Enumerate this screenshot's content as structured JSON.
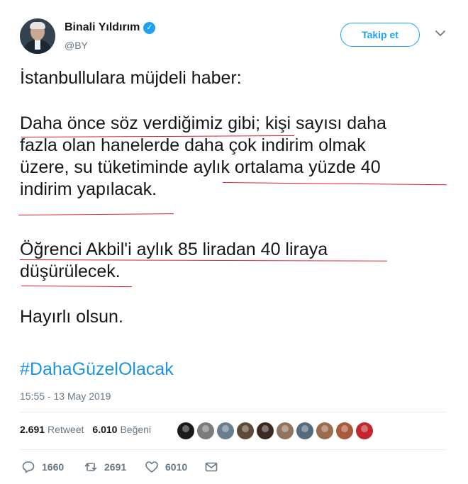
{
  "author": {
    "name": "Binali Yıldırım",
    "handle": "@BY",
    "verified_icon": "verified-badge-icon"
  },
  "header": {
    "follow_label": "Takip et"
  },
  "tweet": {
    "line1": "İstanbullulara müjdeli haber:",
    "p2_l1": "Daha önce söz verdiğimiz gibi; kişi sayısı daha",
    "p2_l2": "fazla olan hanelerde daha çok indirim olmak",
    "p2_l3": "üzere, su tüketiminde aylık ortalama yüzde 40",
    "p2_l4": "indirim yapılacak.",
    "p3_l1": "Öğrenci Akbil'i aylık 85 liradan 40 liraya",
    "p3_l2": "düşürülecek.",
    "closing": "Hayırlı olsun.",
    "hashtag": "#DahaGüzelOlacak"
  },
  "timestamp": "15:55 - 13 May 2019",
  "stats": {
    "retweet_count": "2.691",
    "retweet_label": "Retweet",
    "like_count": "6.010",
    "like_label": "Beğeni"
  },
  "liker_colors": [
    "#1a1a1a",
    "#7c7c7c",
    "#6b7e8d",
    "#5e4a3a",
    "#3b2a22",
    "#8f7560",
    "#556b7d",
    "#9a6b4c",
    "#a85a3a",
    "#c4262e"
  ],
  "actions": {
    "reply_count": "1660",
    "retweet_count": "2691",
    "like_count": "6010"
  },
  "colors": {
    "accent": "#1da1f2",
    "hashtag": "#1b95e0",
    "annotation": "#e21a2c"
  }
}
